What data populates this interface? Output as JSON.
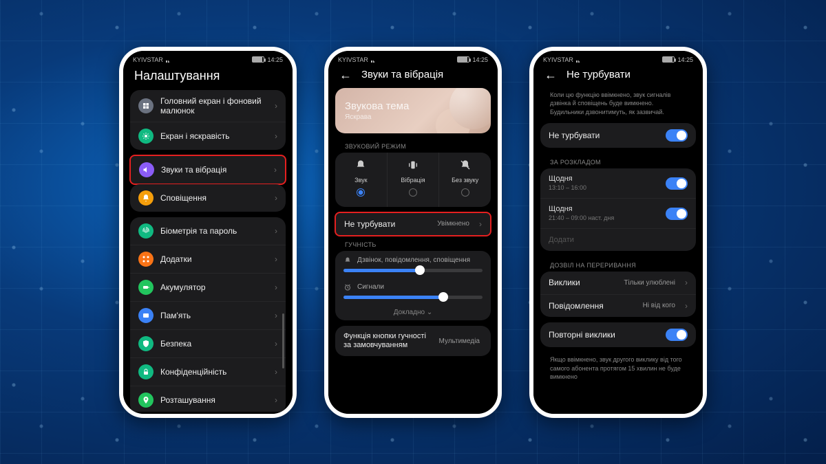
{
  "status": {
    "carrier": "KYIVSTAR",
    "time": "14:25"
  },
  "colors": {
    "accent": "#3b82f6",
    "highlight": "#e52020",
    "icons": {
      "home": "#6b7280",
      "display": "#10b981",
      "sound": "#8b5cf6",
      "notif": "#f59e0b",
      "biometry": "#10b981",
      "apps": "#f97316",
      "battery": "#22c55e",
      "storage": "#3b82f6",
      "security": "#10b981",
      "privacy": "#10b981",
      "location": "#22c55e"
    }
  },
  "p1": {
    "title": "Налаштування",
    "items": [
      {
        "label": "Головний екран і фоновий малюнок"
      },
      {
        "label": "Екран і яскравість"
      },
      {
        "label": "Звуки та вібрація",
        "highlight": true
      },
      {
        "label": "Сповіщення"
      },
      {
        "label": "Біометрія та пароль"
      },
      {
        "label": "Додатки"
      },
      {
        "label": "Акумулятор"
      },
      {
        "label": "Пам'ять"
      },
      {
        "label": "Безпека"
      },
      {
        "label": "Конфіденційність"
      },
      {
        "label": "Розташування"
      }
    ]
  },
  "p2": {
    "title": "Звуки та вібрація",
    "theme": {
      "title": "Звукова тема",
      "sub": "Яскрава"
    },
    "mode_header": "ЗВУКОВИЙ РЕЖИМ",
    "modes": [
      {
        "label": "Звук",
        "selected": true
      },
      {
        "label": "Вібрація",
        "selected": false
      },
      {
        "label": "Без звуку",
        "selected": false
      }
    ],
    "dnd": {
      "label": "Не турбувати",
      "value": "Увімкнено",
      "highlight": true
    },
    "volume_header": "ГУЧНІСТЬ",
    "sliders": [
      {
        "label": "Дзвінок, повідомлення, сповіщення",
        "value": 55
      },
      {
        "label": "Сигнали",
        "value": 72
      }
    ],
    "expand": "Докладно",
    "fn": {
      "label": "Функція кнопки гучності за замовчуванням",
      "value": "Мультимедіа"
    }
  },
  "p3": {
    "title": "Не турбувати",
    "desc": "Коли цю функцію ввімкнено, звук сигналів дзвінка й сповіщень буде вимкнено. Будильники дзвонитимуть, як зазвичай.",
    "main": {
      "label": "Не турбувати",
      "on": true
    },
    "sched_header": "ЗА РОЗКЛАДОМ",
    "schedules": [
      {
        "title": "Щодня",
        "time": "13:10 – 16:00",
        "on": true
      },
      {
        "title": "Щодня",
        "time": "21:40 – 09:00 наст. дня",
        "on": true
      }
    ],
    "add": "Додати",
    "interrupt_header": "ДОЗВІЛ НА ПЕРЕРИВАННЯ",
    "calls": {
      "label": "Виклики",
      "value": "Тільки улюблені"
    },
    "msgs": {
      "label": "Повідомлення",
      "value": "Ні від кого"
    },
    "repeat": {
      "label": "Повторні виклики",
      "on": true
    },
    "repeat_desc": "Якщо ввімкнено, звук другого виклику від того самого абонента протягом 15 хвилин не буде вимкнено"
  }
}
